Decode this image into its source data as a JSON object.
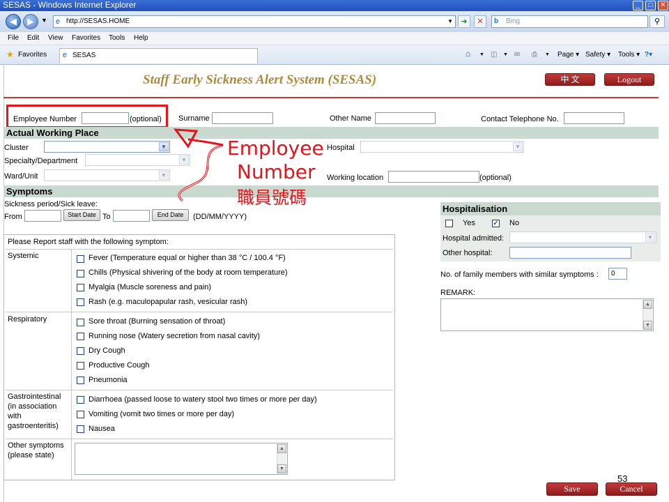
{
  "browser": {
    "window_title": "SESAS - Windows Internet Explorer",
    "address": "http://SESAS.HOME",
    "search_placeholder": "Bing",
    "menus": [
      "File",
      "Edit",
      "View",
      "Favorites",
      "Tools",
      "Help"
    ],
    "favorites_label": "Favorites",
    "tab_label": "SESAS",
    "toolbar": {
      "page": "Page ▾",
      "safety": "Safety ▾",
      "tools": "Tools ▾"
    }
  },
  "header": {
    "title": "Staff Early Sickness Alert System (SESAS)",
    "lang_button": "中 文",
    "logout_button": "Logout"
  },
  "employee": {
    "number_label": "Employee Number",
    "number_value": "",
    "optional": "(optional)",
    "surname_label": "Surname",
    "other_name_label": "Other Name",
    "phone_label": "Contact Telephone No."
  },
  "working_place": {
    "heading": "Actual Working Place",
    "cluster_label": "Cluster",
    "specialty_label": "Specialty/Department",
    "ward_label": "Ward/Unit",
    "hospital_label": "Hospital",
    "location_label": "Working location",
    "location_optional": "(optional)"
  },
  "symptoms_section": {
    "heading": "Symptoms",
    "sick_period_label": "Sickness period/Sick leave:",
    "from_label": "From",
    "start_date_button": "Start Date",
    "to_label": "To",
    "end_date_button": "End Date",
    "date_format": "(DD/MM/YYYY)"
  },
  "symptom_table": {
    "caption": "Please Report staff with the following symptom:",
    "groups": [
      {
        "name": "Systemic",
        "items": [
          "Fever (Temperature equal or higher than 38 °C / 100.4 °F)",
          "Chills (Physical shivering of the body at room temperature)",
          "Myalgia (Muscle soreness and pain)",
          "Rash (e.g. maculopapular rash, vesicular rash)"
        ]
      },
      {
        "name": "Respiratory",
        "items": [
          "Sore throat (Burning sensation of throat)",
          "Running nose (Watery secretion from nasal cavity)",
          "Dry Cough",
          "Productive Cough",
          "Pneumonia"
        ]
      },
      {
        "name": "Gastrointestinal (in association with gastroenteritis)",
        "name_lines": [
          "Gastrointestinal",
          "(in association",
          "with",
          "gastroenteritis)"
        ],
        "items": [
          "Diarrhoea (passed loose to watery stool two times or more per day)",
          "Vomiting (vomit two times or more per day)",
          "Nausea"
        ]
      }
    ],
    "other_label_lines": [
      "Other symptoms",
      "(please state)"
    ]
  },
  "hospitalisation": {
    "heading": "Hospitalisation",
    "yes_label": "Yes",
    "yes_checked": false,
    "no_label": "No",
    "no_checked": true,
    "admitted_label": "Hospital admitted:",
    "other_label": "Other hospital:"
  },
  "family": {
    "label": "No. of family members with similar symptoms :",
    "value": "0"
  },
  "remark_label": "REMARK:",
  "footer": {
    "save_button": "Save",
    "cancel_button": "Cancel",
    "slide_number": "53"
  },
  "annotation": {
    "line1": "Employee",
    "line2": "Number",
    "line3": "職員號碼",
    "color": "#e3141b"
  }
}
